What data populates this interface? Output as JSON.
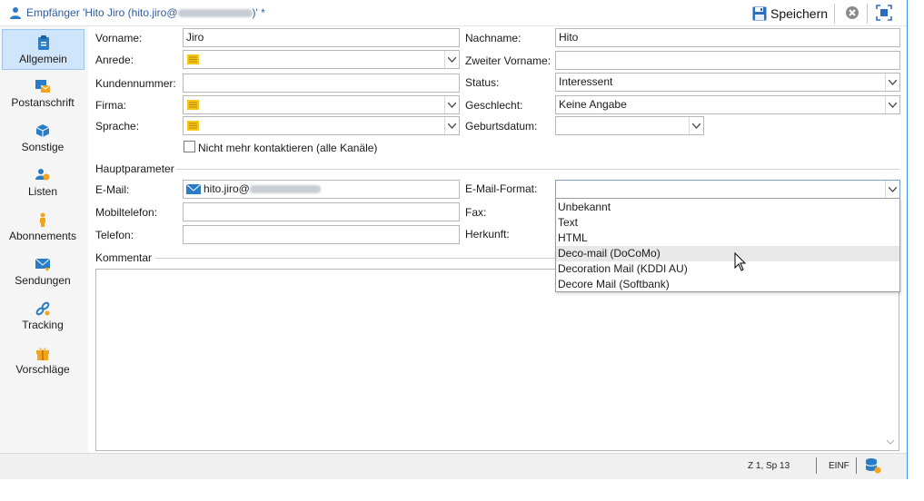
{
  "window": {
    "title_prefix": "Empfänger 'Hito Jiro (hito.jiro@",
    "title_suffix": ")' *",
    "save_label": "Speichern"
  },
  "sidebar": {
    "items": [
      {
        "label": "Allgemein",
        "icon": "clipboard-icon",
        "active": true
      },
      {
        "label": "Postanschrift",
        "icon": "mail-address-icon",
        "active": false
      },
      {
        "label": "Sonstige",
        "icon": "cube-icon",
        "active": false
      },
      {
        "label": "Listen",
        "icon": "users-icon",
        "active": false
      },
      {
        "label": "Abonnements",
        "icon": "person-icon",
        "active": false
      },
      {
        "label": "Sendungen",
        "icon": "envelope-icon",
        "active": false
      },
      {
        "label": "Tracking",
        "icon": "link-icon",
        "active": false
      },
      {
        "label": "Vorschläge",
        "icon": "gift-icon",
        "active": false
      }
    ]
  },
  "form": {
    "vorname": {
      "label": "Vorname:",
      "value": "Jiro"
    },
    "nachname": {
      "label": "Nachname:",
      "value": "Hito"
    },
    "anrede": {
      "label": "Anrede:",
      "value": ""
    },
    "zweiter_vorname": {
      "label": "Zweiter Vorname:",
      "value": ""
    },
    "kundennummer": {
      "label": "Kundennummer:",
      "value": ""
    },
    "status": {
      "label": "Status:",
      "value": "Interessent"
    },
    "firma": {
      "label": "Firma:",
      "value": ""
    },
    "geschlecht": {
      "label": "Geschlecht:",
      "value": "Keine Angabe"
    },
    "sprache": {
      "label": "Sprache:",
      "value": ""
    },
    "geburtsdatum": {
      "label": "Geburtsdatum:",
      "value": ""
    },
    "no_contact": {
      "label": "Nicht mehr kontaktieren (alle Kanäle)",
      "checked": false
    },
    "hauptparameter_label": "Hauptparameter",
    "email": {
      "label": "E-Mail:",
      "value_prefix": "hito.jiro@"
    },
    "email_format": {
      "label": "E-Mail-Format:",
      "value": ""
    },
    "mobiltelefon": {
      "label": "Mobiltelefon:",
      "value": ""
    },
    "fax": {
      "label": "Fax:"
    },
    "telefon": {
      "label": "Telefon:",
      "value": ""
    },
    "herkunft": {
      "label": "Herkunft:"
    },
    "kommentar_label": "Kommentar"
  },
  "email_format_options": [
    "Unbekannt",
    "Text",
    "HTML",
    "Deco-mail (DoCoMo)",
    "Decoration Mail (KDDI AU)",
    "Decore Mail (Softbank)"
  ],
  "email_format_hovered": "Deco-mail (DoCoMo)",
  "statusbar": {
    "position": "Z 1, Sp 13",
    "mode": "EINF"
  },
  "colors": {
    "accent": "#2d5aa0",
    "active_nav": "#cfe5fb",
    "icon_blue": "#2a7cc7",
    "icon_orange": "#f2a51a"
  }
}
